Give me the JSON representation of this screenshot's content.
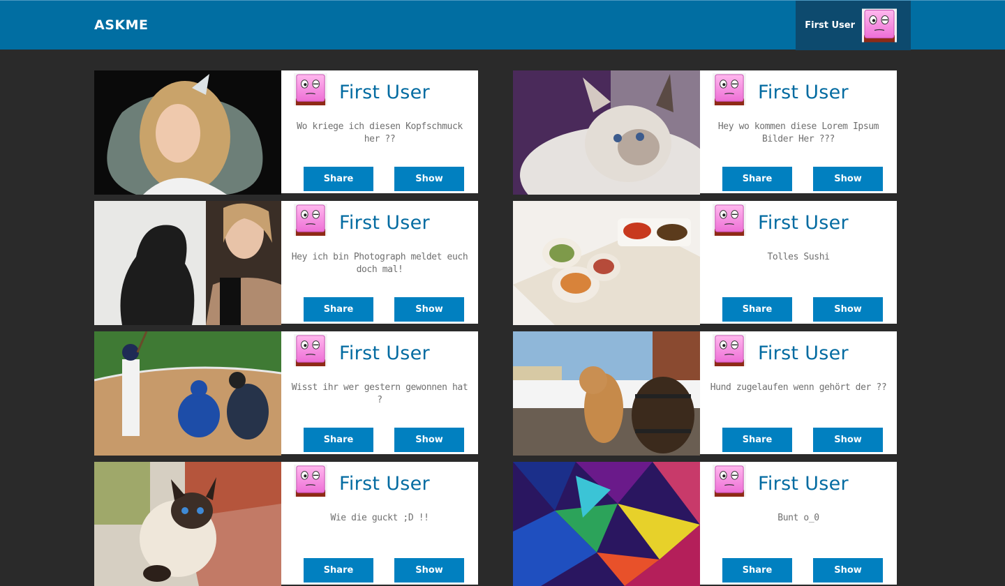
{
  "header": {
    "brand": "ASKME",
    "user_name": "First User",
    "avatar_icon": "pink-face-avatar-icon"
  },
  "colors": {
    "header_bg": "#016ea2",
    "user_box_bg": "#0d4a6e",
    "page_bg": "#2a2a2a",
    "button_bg": "#0180c0",
    "username_text": "#036ba1",
    "question_text": "#6f6f6f"
  },
  "posts": [
    {
      "user": "First User",
      "question": "Wo kriege ich diesen Kopfschmuck her ??",
      "share_label": "Share",
      "show_label": "Show",
      "image": "girl-with-headdress"
    },
    {
      "user": "First User",
      "question": "Hey wo kommen diese Lorem Ipsum Bilder Her ???",
      "share_label": "Share",
      "show_label": "Show",
      "image": "white-cat"
    },
    {
      "user": "First User",
      "question": "Hey ich bin Photograph meldet euch doch mal!",
      "share_label": "Share",
      "show_label": "Show",
      "image": "woman-smoking"
    },
    {
      "user": "First User",
      "question": "Tolles Sushi",
      "share_label": "Share",
      "show_label": "Show",
      "image": "sushi-rolls"
    },
    {
      "user": "First User",
      "question": "Wisst ihr wer gestern gewonnen hat ?",
      "share_label": "Share",
      "show_label": "Show",
      "image": "baseball-game"
    },
    {
      "user": "First User",
      "question": "Hund zugelaufen wenn gehört der ??",
      "share_label": "Share",
      "show_label": "Show",
      "image": "dog-with-barrels"
    },
    {
      "user": "First User",
      "question": "Wie die guckt ;D !!",
      "share_label": "Share",
      "show_label": "Show",
      "image": "siamese-cat-on-steps"
    },
    {
      "user": "First User",
      "question": "Bunt o_0",
      "share_label": "Share",
      "show_label": "Show",
      "image": "colorful-abstract"
    }
  ]
}
